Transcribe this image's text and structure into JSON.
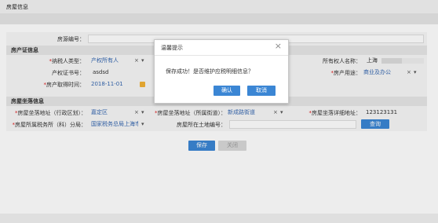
{
  "window": {
    "title": "房屋信息"
  },
  "form": {
    "house_number": {
      "label": "房源编号：",
      "value": ""
    },
    "property_section": {
      "title": "房产证信息"
    },
    "taxpayer_type": {
      "label": "纳税人类型：",
      "value": "产权所有人"
    },
    "owner_name": {
      "label": "所有权人名称：",
      "value": "上海"
    },
    "certificate_no": {
      "label": "产权证书号：",
      "value": "asdsd"
    },
    "house_usage": {
      "label": "房产用途：",
      "value": "商业及办公"
    },
    "acquire_time": {
      "label": "房产取得时间：",
      "value": "2018-11-01"
    },
    "location_section": {
      "title": "房屋坐落信息"
    },
    "district": {
      "label": "房屋坐落地址（行政区划）：",
      "value": "嘉定区"
    },
    "street": {
      "label": "房屋坐落地址（所属街道）：",
      "value": "新成路街道"
    },
    "detail_address": {
      "label": "房屋坐落详细地址：",
      "value": "123123131"
    },
    "tax_office": {
      "label": "房屋所属税务所（科）分局：",
      "value": "国家税务总局上海市"
    },
    "land_number": {
      "label": "房屋所在土地编号：",
      "value": ""
    },
    "query_button": "查询",
    "save_button": "保存",
    "close_button": "关闭"
  },
  "dialog": {
    "title": "温馨提示",
    "message": "保存成功！是否维护应税明细信息？",
    "confirm_button": "确认",
    "cancel_button": "取消",
    "close_glyph": "×"
  },
  "glyphs": {
    "clear": "×",
    "dropdown": "▾"
  }
}
